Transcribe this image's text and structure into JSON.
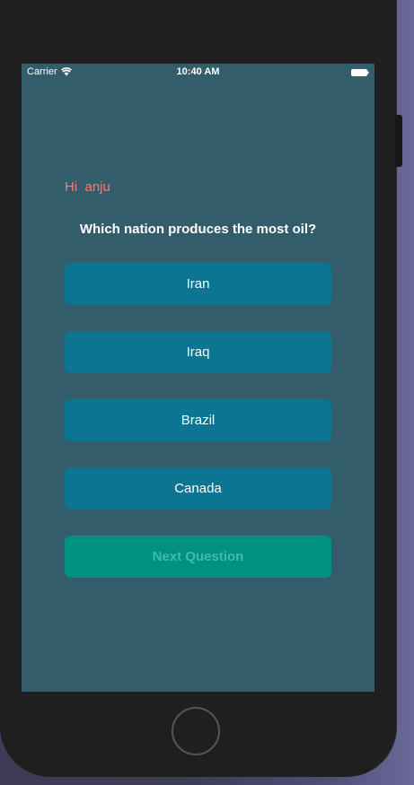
{
  "status_bar": {
    "carrier": "Carrier",
    "time": "10:40 AM",
    "wifi_icon": "wifi-icon",
    "battery_icon": "battery-icon"
  },
  "quiz": {
    "greeting": "Hi  anju",
    "question": "Which nation produces the most oil?",
    "answers": [
      "Iran",
      "Iraq",
      "Brazil",
      "Canada"
    ],
    "next_label": "Next Question"
  },
  "colors": {
    "screen_background": "#345d6b",
    "answer_button": "#0c7592",
    "next_button": "#00927e",
    "next_button_text": "#3dbcae",
    "greeting_text": "#f07e78"
  }
}
